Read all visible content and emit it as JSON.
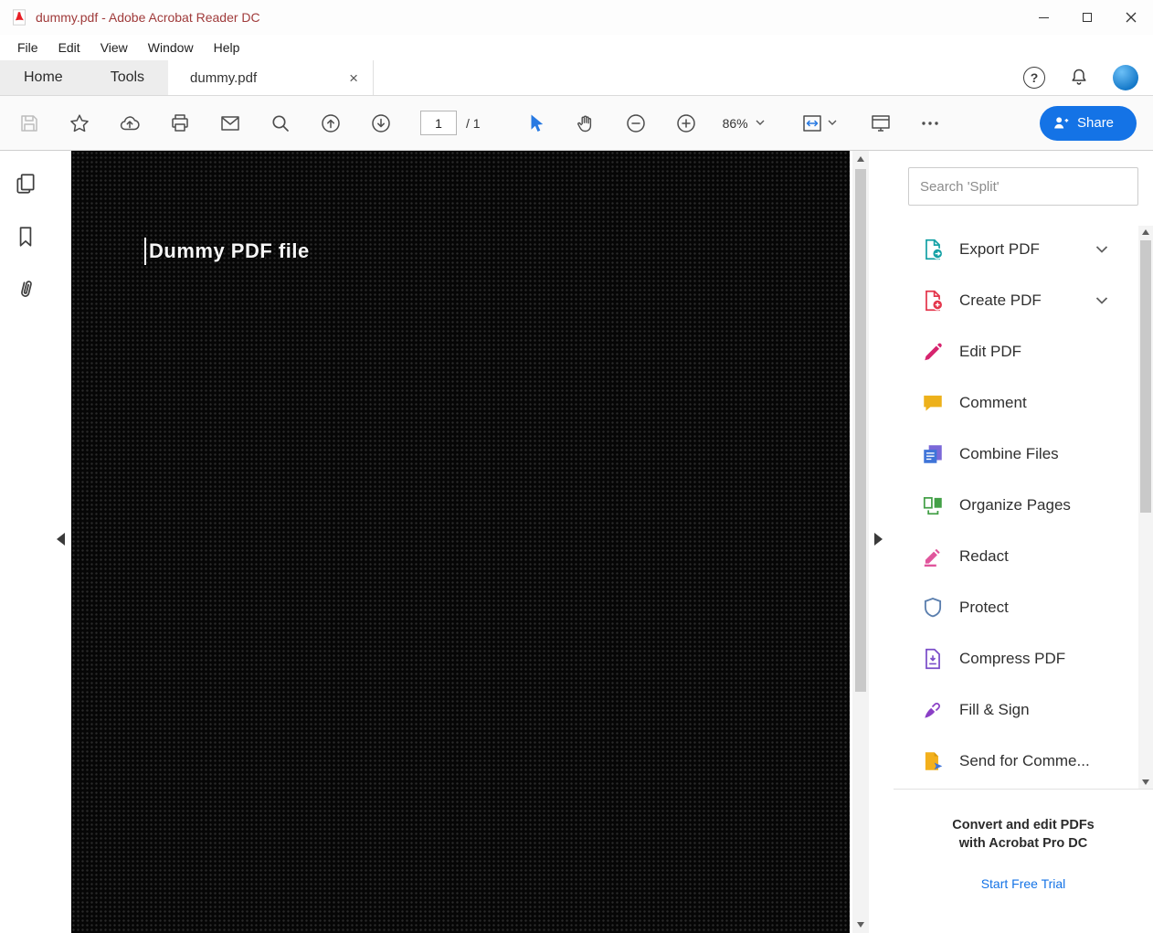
{
  "window": {
    "title": "dummy.pdf - Adobe Acrobat Reader DC"
  },
  "menu": {
    "items": [
      "File",
      "Edit",
      "View",
      "Window",
      "Help"
    ]
  },
  "tabs": {
    "home": "Home",
    "tools": "Tools",
    "document": "dummy.pdf",
    "close_glyph": "×"
  },
  "header": {
    "help_glyph": "?"
  },
  "toolbar": {
    "page_current": "1",
    "page_total": "/ 1",
    "zoom_level": "86%",
    "share_label": "Share"
  },
  "document": {
    "page_text": "Dummy PDF file"
  },
  "right_panel": {
    "search_placeholder": "Search 'Split'",
    "tools": [
      {
        "label": "Export PDF",
        "icon": "export-pdf-icon",
        "color": "#17a2a6",
        "has_chevron": true
      },
      {
        "label": "Create PDF",
        "icon": "create-pdf-icon",
        "color": "#e4364c",
        "has_chevron": true
      },
      {
        "label": "Edit PDF",
        "icon": "edit-pdf-icon",
        "color": "#d6246e",
        "has_chevron": false
      },
      {
        "label": "Comment",
        "icon": "comment-icon",
        "color": "#edb11b",
        "has_chevron": false
      },
      {
        "label": "Combine Files",
        "icon": "combine-files-icon",
        "color": "#3f74d8",
        "has_chevron": false
      },
      {
        "label": "Organize Pages",
        "icon": "organize-pages-icon",
        "color": "#43a047",
        "has_chevron": false
      },
      {
        "label": "Redact",
        "icon": "redact-icon",
        "color": "#e0559c",
        "has_chevron": false
      },
      {
        "label": "Protect",
        "icon": "protect-icon",
        "color": "#5b7fae",
        "has_chevron": false
      },
      {
        "label": "Compress PDF",
        "icon": "compress-pdf-icon",
        "color": "#7a4dc9",
        "has_chevron": false
      },
      {
        "label": "Fill & Sign",
        "icon": "fill-sign-icon",
        "color": "#8a3fc6",
        "has_chevron": false
      },
      {
        "label": "Send for Comme...",
        "icon": "send-comments-icon",
        "color": "#f3b01c",
        "has_chevron": false
      }
    ],
    "promo": {
      "line1": "Convert and edit PDFs",
      "line2": "with Acrobat Pro DC",
      "cta": "Start Free Trial"
    }
  },
  "colors": {
    "accent_blue": "#1473e6",
    "title_text": "#a03b3b",
    "select_tool_blue": "#2779e2",
    "avatar_blue": "#1579c9"
  }
}
